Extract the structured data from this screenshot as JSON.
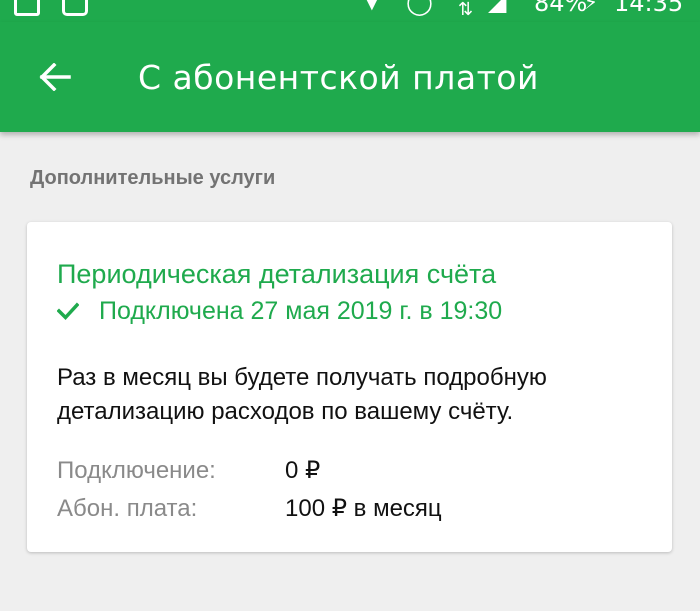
{
  "status_bar": {
    "battery": "84%",
    "time": "14:35",
    "icons": [
      "image-icon",
      "chat-icon",
      "location-icon",
      "alarm-icon",
      "data-transfer-icon",
      "signal-icon",
      "battery-charging-icon"
    ]
  },
  "app_bar": {
    "back_icon": "arrow-back-icon",
    "title": "С абонентской платой"
  },
  "section": {
    "header": "Дополнительные услуги"
  },
  "card": {
    "title": "Периодическая детализация счёта",
    "status_icon": "check-icon",
    "status_text": "Подключена 27 мая 2019 г. в 19:30",
    "description": "Раз в месяц вы будете получать подробную детализацию расходов по вашему счёту.",
    "details": [
      {
        "label": "Подключение:",
        "value": "0 ₽"
      },
      {
        "label": "Абон. плата:",
        "value": "100 ₽ в месяц"
      }
    ]
  },
  "colors": {
    "brand_green": "#1faa4d",
    "background": "#efefef",
    "card": "#ffffff",
    "muted_text": "#8a8a8a",
    "section_header": "#737373"
  }
}
